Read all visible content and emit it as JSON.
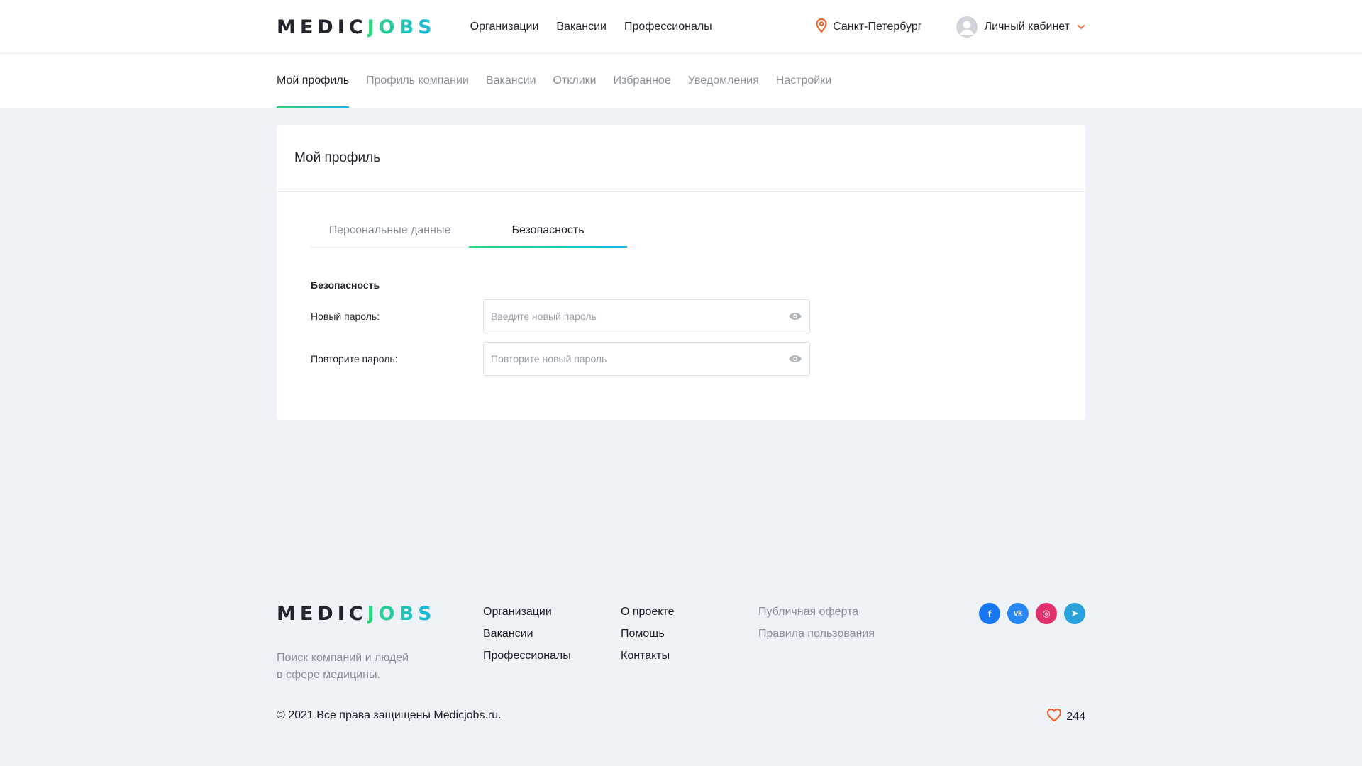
{
  "brand": {
    "part1": "MEDIC",
    "part2": "JOBS"
  },
  "header": {
    "nav": [
      "Организации",
      "Вакансии",
      "Профессионалы"
    ],
    "city": "Санкт-Петербург",
    "account": "Личный кабинет"
  },
  "subnav": {
    "items": [
      "Мой профиль",
      "Профиль компании",
      "Вакансии",
      "Отклики",
      "Избранное",
      "Уведомления",
      "Настройки"
    ],
    "active": "Мой профиль"
  },
  "card": {
    "title": "Мой профиль",
    "tabs": [
      "Персональные данные",
      "Безопасность"
    ],
    "active_tab": "Безопасность",
    "section_title": "Безопасность",
    "fields": [
      {
        "label": "Новый пароль:",
        "placeholder": "Введите новый пароль"
      },
      {
        "label": "Повторите пароль:",
        "placeholder": "Повторите новый пароль"
      }
    ]
  },
  "footer": {
    "tagline_line1": "Поиск компаний и людей",
    "tagline_line2": "в сфере медицины.",
    "col1": [
      "Организации",
      "Вакансии",
      "Профессионалы"
    ],
    "col2": [
      "О проекте",
      "Помощь",
      "Контакты"
    ],
    "col3": [
      "Публичная оферта",
      "Правила пользования"
    ],
    "social": [
      {
        "icon": "facebook-icon",
        "glyph": "f",
        "color": "#1877f2"
      },
      {
        "icon": "vk-icon",
        "glyph": "vk",
        "color": "#2787f5"
      },
      {
        "icon": "instagram-icon",
        "glyph": "◎",
        "color": "#e1306c"
      },
      {
        "icon": "telegram-icon",
        "glyph": "➤",
        "color": "#2aa3dc"
      }
    ],
    "copyright": "© 2021 Все права защищены Medicjobs.ru.",
    "likes": "244"
  },
  "colors": {
    "accent_green": "#2ed47a",
    "accent_blue": "#17b6e8",
    "pin_orange": "#f15a22",
    "heart": "#f15a22"
  }
}
